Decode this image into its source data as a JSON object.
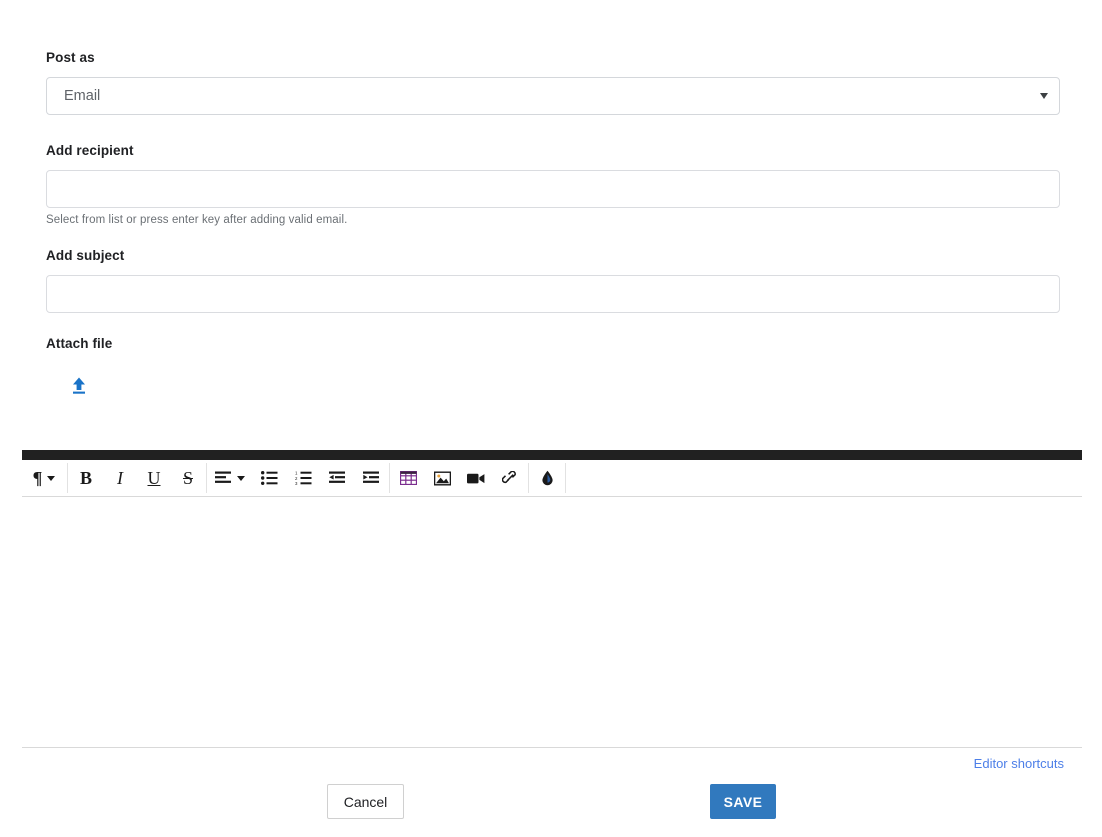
{
  "form": {
    "post_as": {
      "label": "Post as",
      "selected": "Email",
      "options": [
        "Email"
      ],
      "caret_icon": "chevron-down-icon"
    },
    "recipient": {
      "label": "Add recipient",
      "value": "",
      "placeholder": "",
      "helper": "Select from list or press enter key after adding valid email."
    },
    "subject": {
      "label": "Add subject",
      "value": "",
      "placeholder": ""
    },
    "attach": {
      "label": "Attach file",
      "icon": "upload-icon",
      "icon_color": "#1a73c8"
    }
  },
  "editor": {
    "content": "",
    "toolbar": [
      {
        "name": "paragraph-format-dropdown",
        "glyph": "¶",
        "has_caret": true
      },
      {
        "name": "bold-button",
        "glyph": "B"
      },
      {
        "name": "italic-button",
        "glyph": "I"
      },
      {
        "name": "underline-button",
        "glyph": "U"
      },
      {
        "name": "strikethrough-button",
        "glyph": "S"
      },
      {
        "name": "align-dropdown",
        "glyph": "align-left-icon",
        "has_caret": true
      },
      {
        "name": "bullet-list-button",
        "glyph": "bullet-list-icon"
      },
      {
        "name": "numbered-list-button",
        "glyph": "numbered-list-icon"
      },
      {
        "name": "outdent-button",
        "glyph": "outdent-icon"
      },
      {
        "name": "indent-button",
        "glyph": "indent-icon"
      },
      {
        "name": "insert-table-button",
        "glyph": "table-icon"
      },
      {
        "name": "insert-image-button",
        "glyph": "image-icon"
      },
      {
        "name": "insert-video-button",
        "glyph": "video-icon"
      },
      {
        "name": "insert-link-button",
        "glyph": "link-icon"
      },
      {
        "name": "color-fill-button",
        "glyph": "droplet-icon"
      }
    ]
  },
  "footer": {
    "shortcuts_link": "Editor shortcuts",
    "cancel_label": "Cancel",
    "save_label": "SAVE",
    "save_color": "#3179be",
    "link_color": "#4d7fe8"
  }
}
